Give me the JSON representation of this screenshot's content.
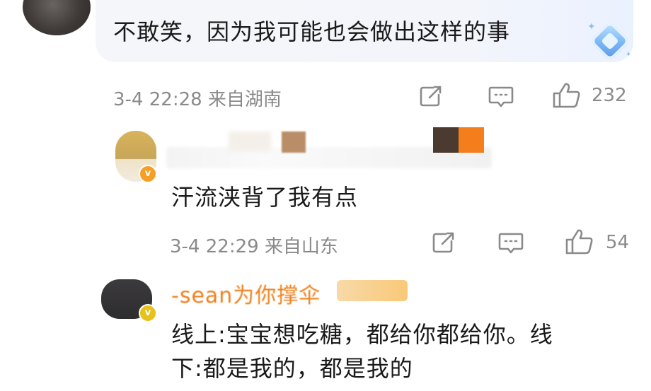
{
  "comments": [
    {
      "text": "不敢笑，因为我可能也会做出这样的事",
      "meta": "3-4 22:28 来自湖南",
      "likes": "232"
    },
    {
      "text": "汗流浃背了我有点",
      "meta": "3-4 22:29 来自山东",
      "likes": "54"
    },
    {
      "username": "-sean为你撑伞",
      "text_line1": "线上:宝宝想吃糖，都给你都给你。线",
      "text_line2": "下:都是我的，都是我的"
    }
  ],
  "icons": [
    "share-icon",
    "comment-icon",
    "like-icon",
    "verified-badge-icon",
    "gem-icon"
  ],
  "colors": {
    "meta_gray": "#8a8a8a",
    "username_orange": "#f07f19",
    "badge_orange": "#f59f25",
    "bubble_bg": "#f5f6f9"
  }
}
